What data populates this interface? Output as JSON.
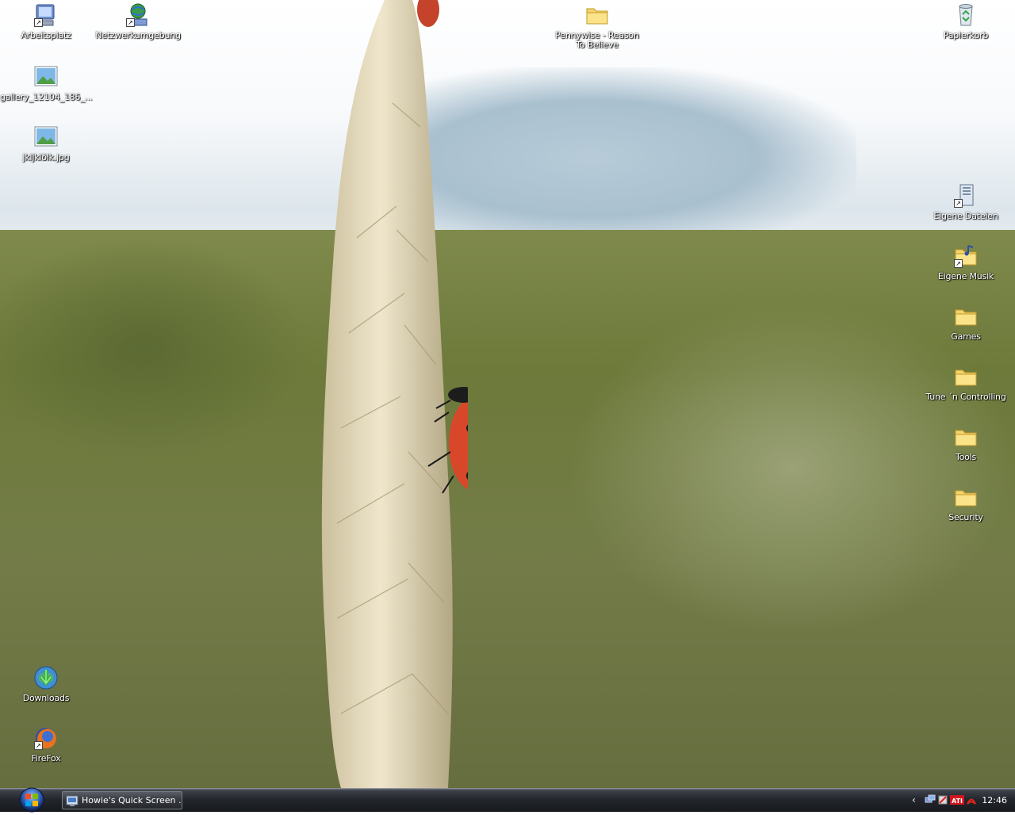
{
  "desktop": {
    "icons": [
      {
        "label": "Arbeitsplatz",
        "icon": "computer-icon"
      },
      {
        "label": "Netzwerkumgebung",
        "icon": "network-icon"
      },
      {
        "label": "gallery_12104_186_...",
        "icon": "image-file-icon"
      },
      {
        "label": "jkljklölk.jpg",
        "icon": "image-file-icon"
      },
      {
        "label": "Pennywise - Reason To Believe",
        "icon": "folder-icon"
      },
      {
        "label": "Papierkorb",
        "icon": "recycle-bin-icon"
      },
      {
        "label": "Eigene Dateien",
        "icon": "documents-icon"
      },
      {
        "label": "Eigene Musik",
        "icon": "music-folder-icon"
      },
      {
        "label": "Games",
        "icon": "folder-icon"
      },
      {
        "label": "Tune ´n Controlling",
        "icon": "folder-icon"
      },
      {
        "label": "Tools",
        "icon": "folder-icon"
      },
      {
        "label": "Security",
        "icon": "folder-icon"
      },
      {
        "label": "Downloads",
        "icon": "downloads-icon"
      },
      {
        "label": "FireFox",
        "icon": "firefox-icon"
      }
    ]
  },
  "taskbar": {
    "start_icon": "windows-logo-icon",
    "tasks": [
      {
        "label": "Howie's Quick Screen ...",
        "icon": "app-icon"
      }
    ],
    "tray": {
      "expand_icon": "chevron-left-icon",
      "icons": [
        "network-tray-icon",
        "antivirus-tray-icon",
        "ati-tray-icon",
        "acrobat-tray-icon"
      ],
      "clock": "12:46"
    }
  },
  "colors": {
    "taskbar": "#1d1f24",
    "folder": "#f5d46b",
    "ladybug": "#d9472a"
  }
}
